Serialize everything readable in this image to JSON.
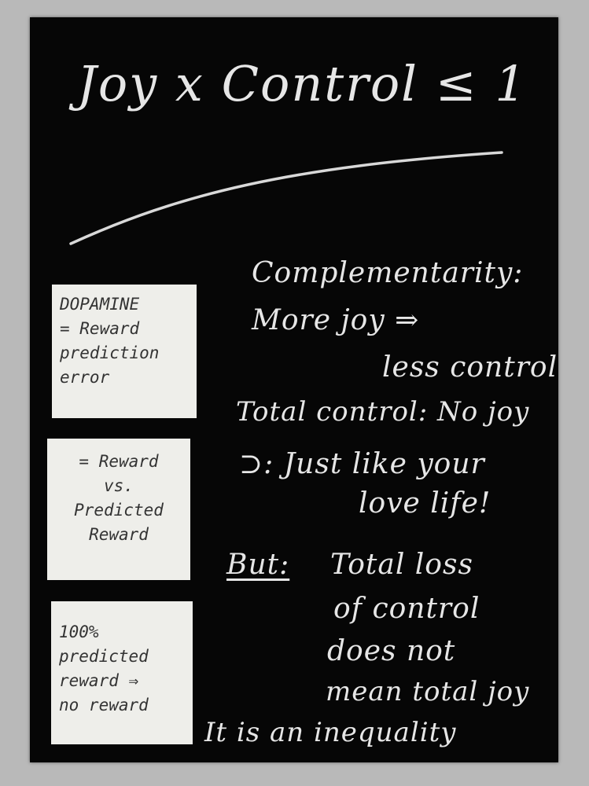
{
  "title": "Joy x Control ≤ 1",
  "notes": {
    "note1": [
      "DOPAMINE",
      "= Reward",
      "prediction",
      "error"
    ],
    "note2": [
      "= Reward",
      "vs.",
      "Predicted",
      "Reward"
    ],
    "note3": [
      "100%",
      "predicted",
      "reward ⇒",
      "no reward"
    ]
  },
  "main": {
    "complementarity": "Complementarity:",
    "more_joy": "More joy ⇒",
    "less_control": "less control",
    "total_control": "Total control: No joy",
    "just_like": "⊃: Just like your",
    "love_life": "love life!",
    "but": "But:",
    "total_loss": "Total loss",
    "of_control": "of control",
    "does_not": "does not",
    "mean_total_joy": "mean total joy",
    "inequality": "It is an inequality"
  }
}
